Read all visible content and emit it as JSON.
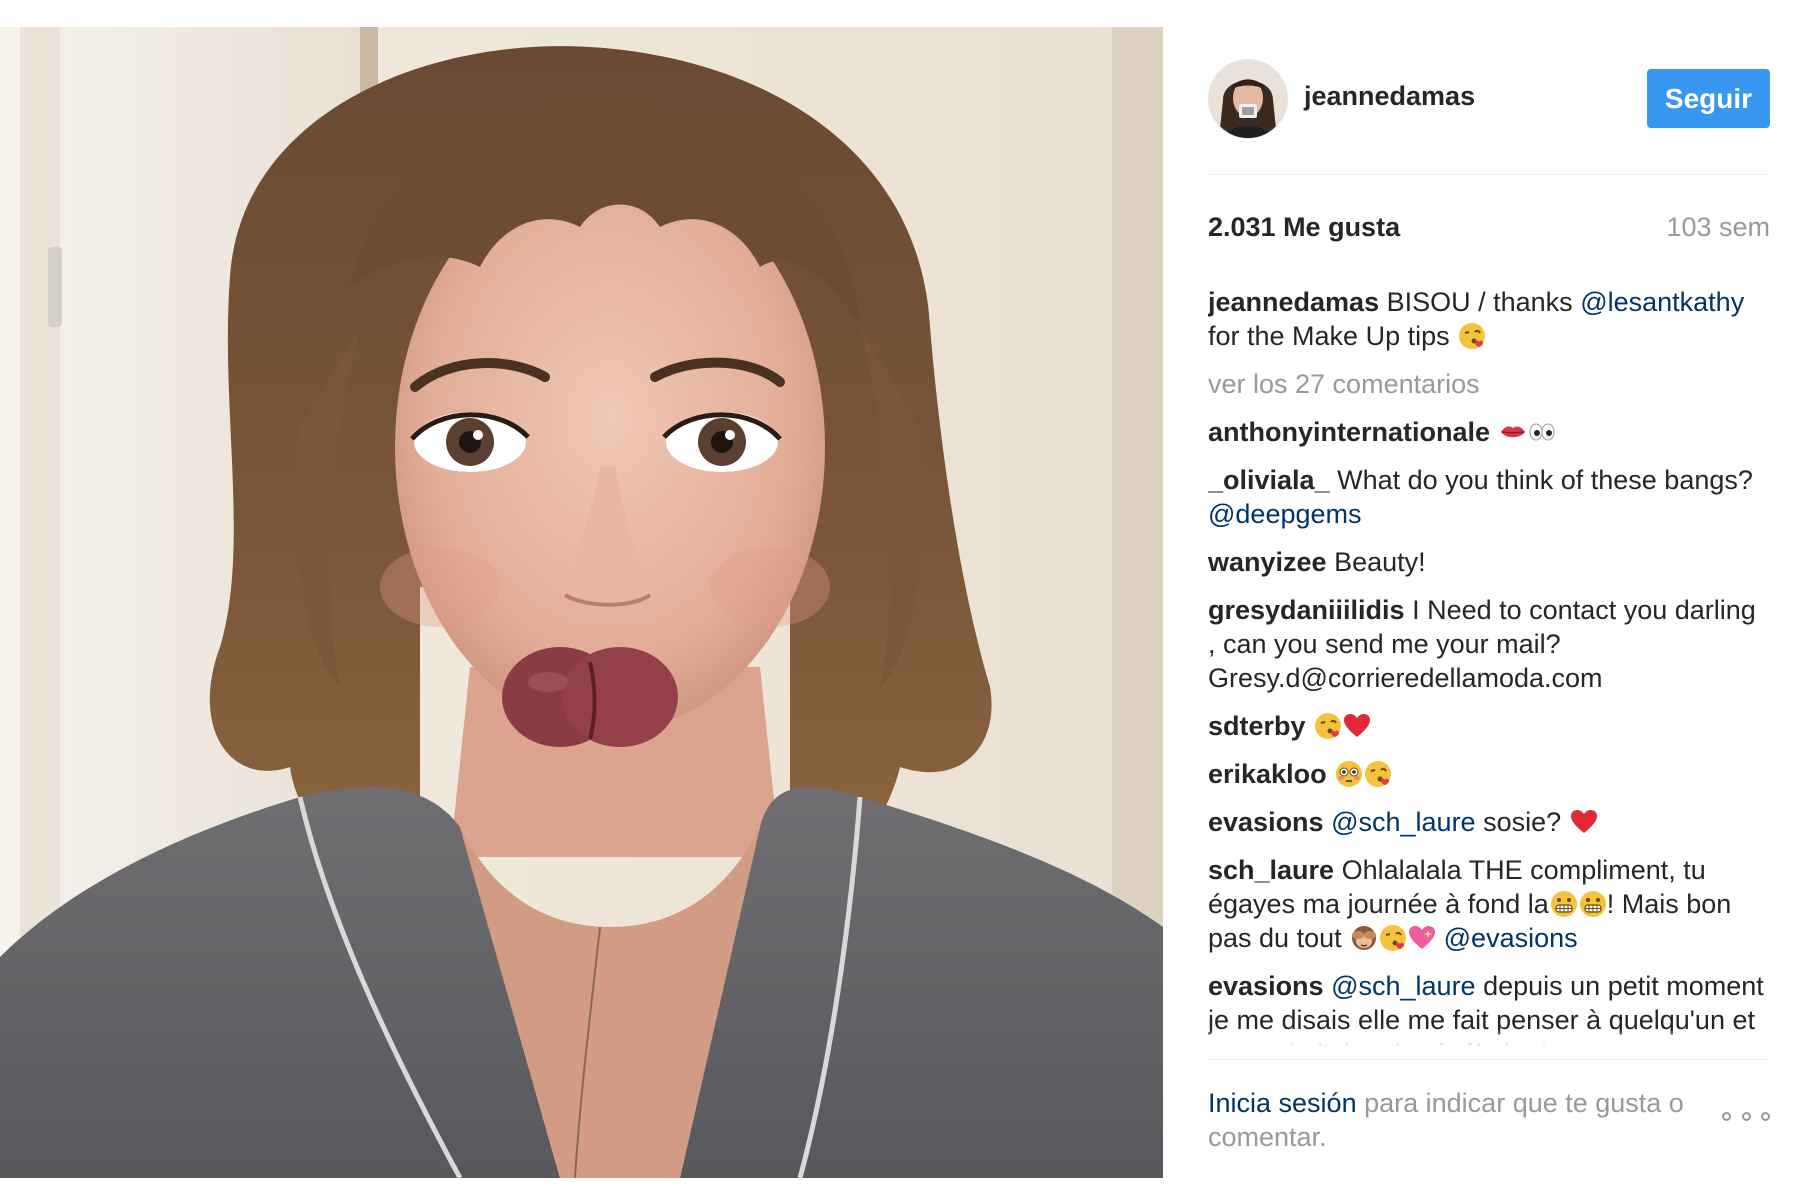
{
  "post": {
    "photo_alt": "",
    "header": {
      "username": "jeannedamas",
      "follow_label": "Seguir"
    },
    "stats": {
      "likes": "2.031 Me gusta",
      "time_ago": "103 sem"
    },
    "caption": {
      "user": "jeannedamas",
      "text_before": "BISOU / thanks",
      "mention": "@lesantkathy",
      "text_after": "for the Make Up tips",
      "emoji": "kiss-face-emoji"
    },
    "view_all_comments": "ver los 27 comentarios",
    "comments": [
      {
        "user": "anthonyinternationale",
        "emojis": [
          "lips-emoji",
          "eyes-emoji"
        ]
      },
      {
        "user": "_oliviala_",
        "text": "What do you think of these bangs?",
        "mention": "@deepgems"
      },
      {
        "user": "wanyizee",
        "text": "Beauty!"
      },
      {
        "user": "gresydaniiilidis",
        "text": "I Need to contact you darling , can you send me your mail? Gresy.d@corrieredellamoda.com"
      },
      {
        "user": "sdterby",
        "emojis": [
          "kiss-face-emoji",
          "red-heart-emoji"
        ]
      },
      {
        "user": "erikakloo",
        "emojis": [
          "flushed-face-emoji",
          "kiss-face-emoji"
        ]
      },
      {
        "user": "evasions",
        "mention": "@sch_laure",
        "text": "sosie?",
        "emojis": [
          "red-heart-emoji"
        ]
      },
      {
        "user": "sch_laure",
        "text_a": "Ohlalalala THE compliment, tu égayes ma journée à fond la",
        "emojis_a": [
          "grimace-emoji",
          "grimace-emoji"
        ],
        "text_b": "! Mais bon pas du tout",
        "emojis_b": [
          "see-no-evil-monkey-emoji",
          "kiss-face-emoji",
          "sparkling-heart-emoji"
        ],
        "mention": "@evasions"
      },
      {
        "user": "evasions",
        "mention": "@sch_laure",
        "text": "depuis un petit moment je me disais elle me fait penser à quelqu'un et ce matin j'ai eu la révélation!"
      }
    ],
    "footer": {
      "login_link": "Inicia sesión",
      "login_text": "para indicar que te gusta o comentar.",
      "more_icon": "more-options-icon"
    }
  },
  "colors": {
    "follow_button": "#3897f0",
    "mention": "#003569",
    "muted_text": "#999999",
    "primary_text": "#262626",
    "divider": "#efefef"
  }
}
